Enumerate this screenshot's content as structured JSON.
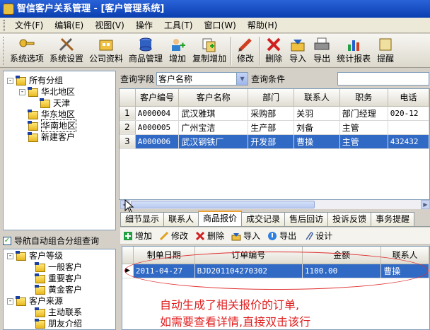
{
  "window": {
    "title": "智信客户关系管理 - [客户管理系统]"
  },
  "menu": [
    "文件(F)",
    "编辑(E)",
    "视图(V)",
    "操作",
    "工具(T)",
    "窗口(W)",
    "帮助(H)"
  ],
  "toolbar": [
    "系统选项",
    "系统设置",
    "公司资料",
    "商品管理",
    "增加",
    "复制增加",
    "修改",
    "删除",
    "导入",
    "导出",
    "统计报表",
    "提醒"
  ],
  "tree": [
    {
      "label": "所有分组",
      "expander": "-"
    },
    {
      "label": "华北地区",
      "expander": "-"
    },
    {
      "label": "天津",
      "expander": ""
    },
    {
      "label": "华东地区",
      "expander": ""
    },
    {
      "label": "华南地区",
      "expander": ""
    },
    {
      "label": "新建客户",
      "expander": ""
    }
  ],
  "nav_auto": {
    "label": "导航自动组合分组查询",
    "checked": true
  },
  "tree2": [
    {
      "label": "客户等级",
      "expander": "-"
    },
    {
      "label": "一般客户",
      "expander": ""
    },
    {
      "label": "重要客户",
      "expander": ""
    },
    {
      "label": "黄金客户",
      "expander": ""
    },
    {
      "label": "客户来源",
      "expander": "-"
    },
    {
      "label": "主动联系",
      "expander": ""
    },
    {
      "label": "朋友介绍",
      "expander": ""
    }
  ],
  "query": {
    "field_label": "查询字段",
    "field_value": "客户名称",
    "cond_label": "查询条件",
    "cond_value": ""
  },
  "customers": {
    "columns": [
      "",
      "客户编号",
      "客户名称",
      "部门",
      "联系人",
      "职务",
      "电话"
    ],
    "rows": [
      [
        "1",
        "A000004",
        "武汉雅琪",
        "采购部",
        "关羽",
        "部门经理",
        "020-12"
      ],
      [
        "2",
        "A000005",
        "广州宝洁",
        "生产部",
        "刘备",
        "主管",
        ""
      ],
      [
        "3",
        "A000006",
        "武汉钢铁厂",
        "开发部",
        "曹操",
        "主管",
        "432432"
      ]
    ],
    "selected_row": 2
  },
  "tabs": [
    "细节显示",
    "联系人",
    "商品报价",
    "成交记录",
    "售后回访",
    "投诉反馈",
    "事务提醒"
  ],
  "active_tab": 2,
  "subtoolbar": [
    "增加",
    "修改",
    "删除",
    "导入",
    "导出",
    "设计"
  ],
  "orders": {
    "columns": [
      "",
      "制单日期",
      "订单编号",
      "金额",
      "联系人"
    ],
    "rows": [
      [
        "▶",
        "2011-04-27",
        "BJD201104270302",
        "1100.00",
        "曹操"
      ]
    ]
  },
  "annotation": [
    "自动生成了相关报价的订单,",
    "如需要查看详情,直接双击该行"
  ],
  "colors": {
    "title": "#0a3fb0",
    "selection": "#316ac5",
    "annotation": "#e02020"
  }
}
